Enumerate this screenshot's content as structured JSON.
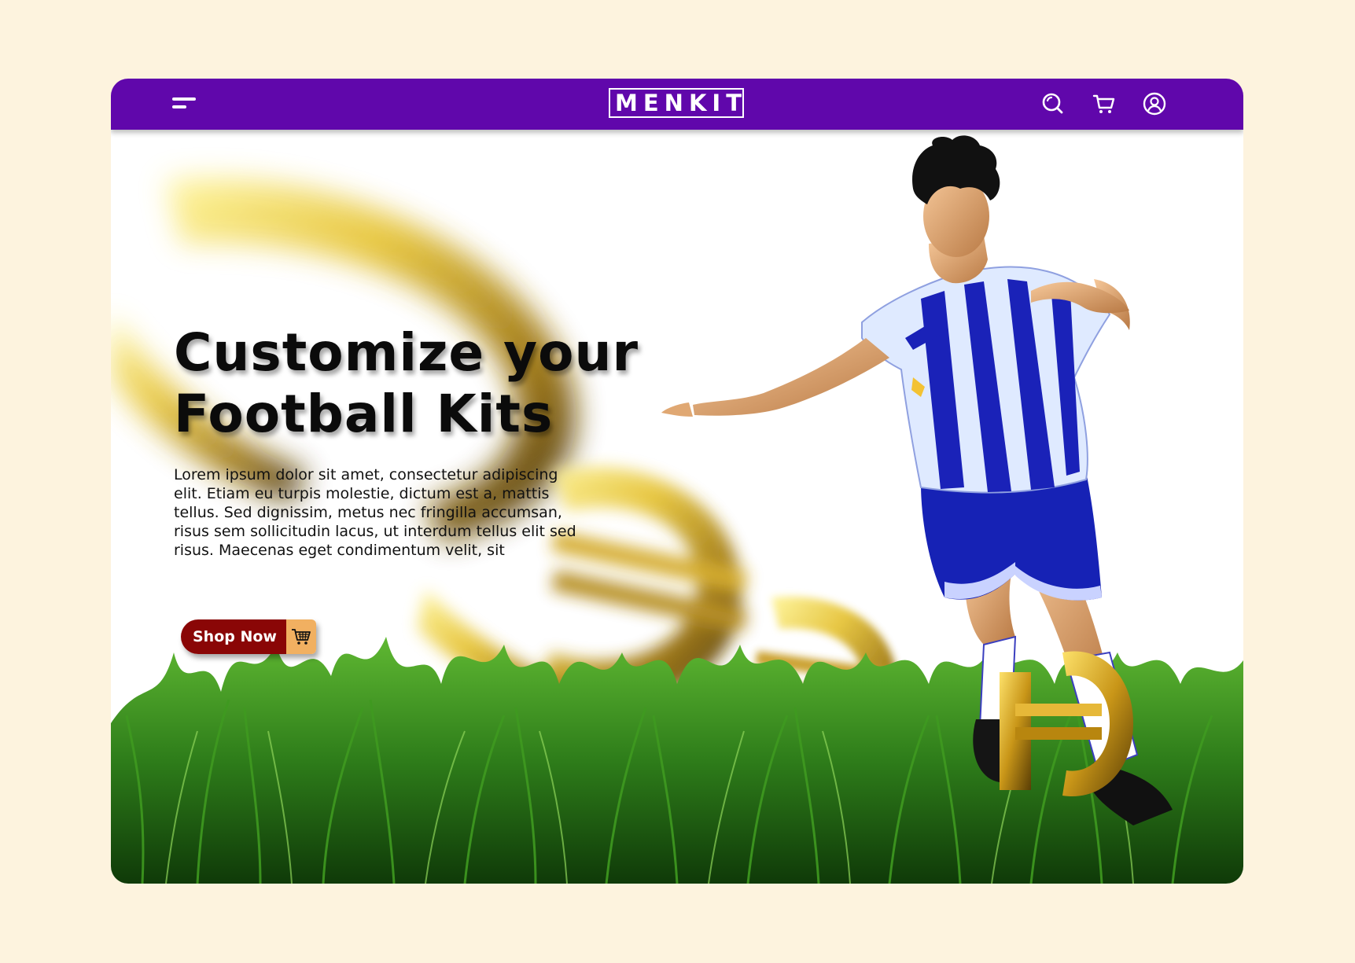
{
  "brand": {
    "logo_text": "MENKIT",
    "primary_color": "#6007ab",
    "background_color": "#fdf3de",
    "button_color": "#8a0606",
    "button_icon_color": "#f1b061"
  },
  "navbar": {
    "menu_icon": "hamburger-menu-icon",
    "icons": [
      "search-icon",
      "cart-icon",
      "user-account-icon"
    ]
  },
  "hero": {
    "title_line_1": "Customize your",
    "title_line_2": "Football Kits",
    "description": "Lorem ipsum dolor sit amet, consectetur adipiscing elit. Etiam eu turpis molestie, dictum est a, mattis tellus. Sed dignissim, metus nec fringilla accumsan, risus sem sollicitudin lacus, ut interdum tellus elit sed risus. Maecenas eget condimentum velit, sit",
    "cta_label": "Shop Now",
    "cta_icon": "shopping-cart-icon"
  }
}
